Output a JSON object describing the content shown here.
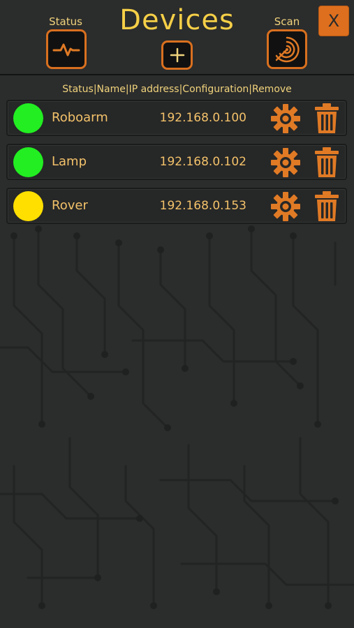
{
  "header": {
    "title": "Devices",
    "status_label": "Status",
    "scan_label": "Scan",
    "close_label": "X"
  },
  "columns_text": "Status|Name|IP address|Configuration|Remove",
  "devices": [
    {
      "name": "Roboarm",
      "ip": "192.168.0.100",
      "status_color": "#22ee22"
    },
    {
      "name": "Lamp",
      "ip": "192.168.0.102",
      "status_color": "#22ee22"
    },
    {
      "name": "Rover",
      "ip": "192.168.0.153",
      "status_color": "#ffdf00"
    }
  ],
  "colors": {
    "accent": "#de6f1e",
    "title": "#f5cf47",
    "text": "#f3c26a",
    "background": "#2b2c2c"
  },
  "icons": {
    "status": "pulse-icon",
    "add": "plus-icon",
    "scan": "radar-icon",
    "config": "gear-icon",
    "remove": "trash-icon"
  }
}
